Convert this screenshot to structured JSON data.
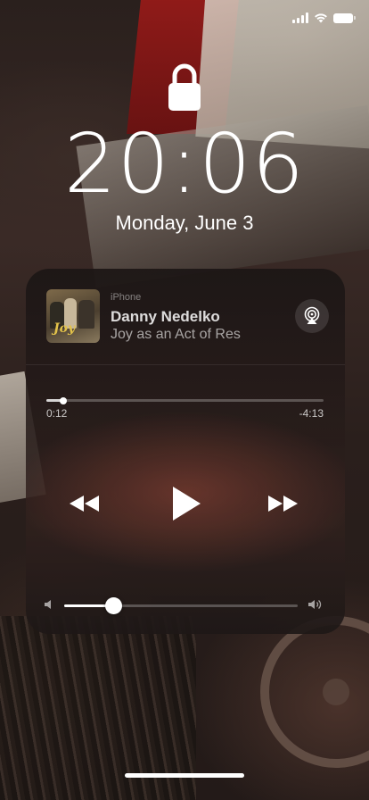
{
  "status_bar": {
    "signal_icon": "cellular-signal-icon",
    "wifi_icon": "wifi-icon",
    "battery_icon": "battery-icon"
  },
  "lock_screen": {
    "lock_icon": "lock-icon",
    "time": "20:06",
    "date": "Monday, June 3"
  },
  "now_playing": {
    "device": "iPhone",
    "title": "Danny Nedelko",
    "subtitle": "Joy as an Act of Res",
    "album_art_logo": "Joy",
    "airplay_icon": "airplay-audio-icon",
    "elapsed": "0:12",
    "remaining": "-4:13",
    "progress_fraction": 0.06,
    "controls": {
      "rewind_icon": "rewind-icon",
      "play_icon": "play-icon",
      "forward_icon": "fast-forward-icon"
    },
    "volume": {
      "low_icon": "volume-low-icon",
      "high_icon": "volume-high-icon",
      "level_fraction": 0.21
    }
  },
  "colors": {
    "text_primary": "#ffffff",
    "card_background": "#241b19"
  }
}
